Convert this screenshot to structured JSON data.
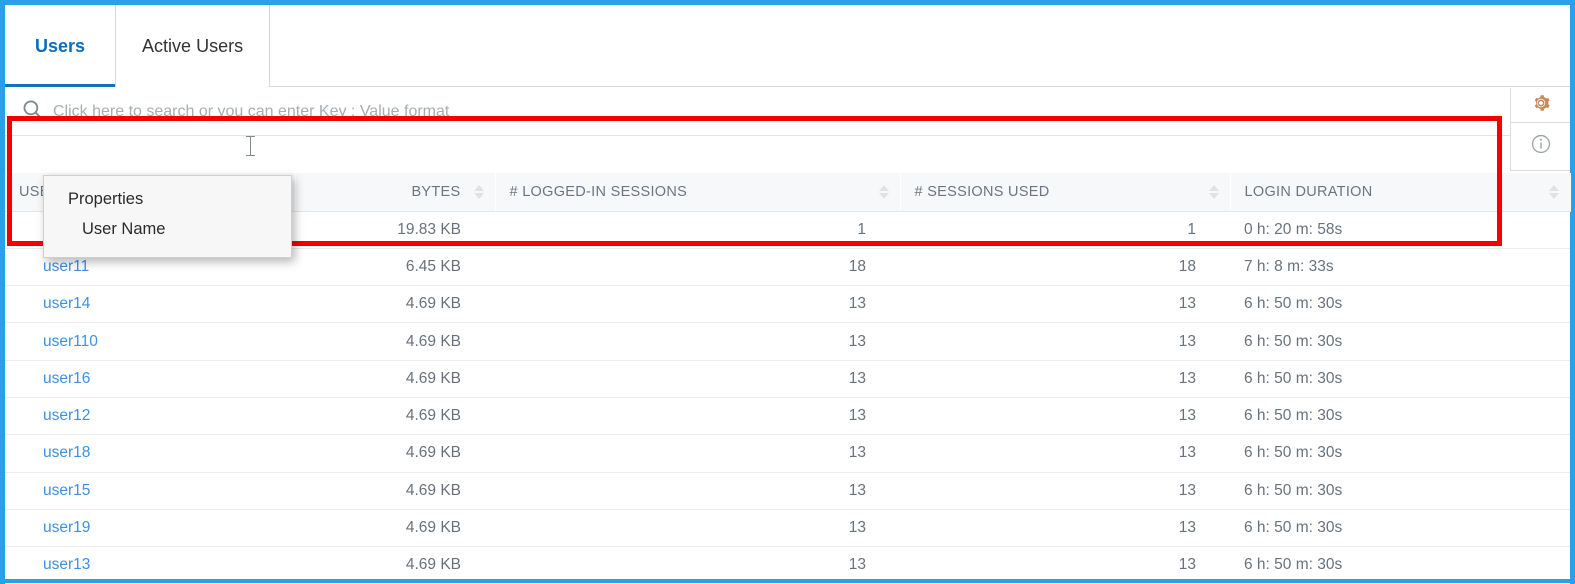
{
  "theme": {
    "frame_border": "#29a0e8",
    "accent_blue": "#0a6ebd",
    "link_blue": "#3a91e2",
    "highlight_red": "#f40000",
    "gear_orange": "#c98a5a",
    "header_bg": "#f7f8fa"
  },
  "tabs": [
    {
      "label": "Users",
      "active": true
    },
    {
      "label": "Active Users",
      "active": false
    }
  ],
  "rail": {
    "gear_icon": "gear-icon",
    "info_icon": "info-circle-icon"
  },
  "search": {
    "icon": "search-icon",
    "value": "",
    "placeholder": "Click here to search or you can enter Key : Value format"
  },
  "suggestions": {
    "header": "Properties",
    "items": [
      {
        "label": "User Name"
      }
    ]
  },
  "table": {
    "columns": [
      {
        "key": "user",
        "label": "USER NAME",
        "align": "left",
        "sortable": true
      },
      {
        "key": "bytes",
        "label": "BYTES",
        "align": "right",
        "sortable": true
      },
      {
        "key": "logged",
        "label": "# LOGGED-IN SESSIONS",
        "align": "right",
        "sortable": true
      },
      {
        "key": "used",
        "label": "# SESSIONS USED",
        "align": "right",
        "sortable": true
      },
      {
        "key": "dur",
        "label": "LOGIN DURATION",
        "align": "left",
        "sortable": true
      }
    ],
    "rows": [
      {
        "user": "",
        "bytes": "19.83 KB",
        "logged": "1",
        "used": "1",
        "dur": "0 h: 20 m: 58s"
      },
      {
        "user": "user11",
        "bytes": "6.45 KB",
        "logged": "18",
        "used": "18",
        "dur": "7 h: 8 m: 33s"
      },
      {
        "user": "user14",
        "bytes": "4.69 KB",
        "logged": "13",
        "used": "13",
        "dur": "6 h: 50 m: 30s"
      },
      {
        "user": "user110",
        "bytes": "4.69 KB",
        "logged": "13",
        "used": "13",
        "dur": "6 h: 50 m: 30s"
      },
      {
        "user": "user16",
        "bytes": "4.69 KB",
        "logged": "13",
        "used": "13",
        "dur": "6 h: 50 m: 30s"
      },
      {
        "user": "user12",
        "bytes": "4.69 KB",
        "logged": "13",
        "used": "13",
        "dur": "6 h: 50 m: 30s"
      },
      {
        "user": "user18",
        "bytes": "4.69 KB",
        "logged": "13",
        "used": "13",
        "dur": "6 h: 50 m: 30s"
      },
      {
        "user": "user15",
        "bytes": "4.69 KB",
        "logged": "13",
        "used": "13",
        "dur": "6 h: 50 m: 30s"
      },
      {
        "user": "user19",
        "bytes": "4.69 KB",
        "logged": "13",
        "used": "13",
        "dur": "6 h: 50 m: 30s"
      },
      {
        "user": "user13",
        "bytes": "4.69 KB",
        "logged": "13",
        "used": "13",
        "dur": "6 h: 50 m: 30s"
      }
    ]
  }
}
